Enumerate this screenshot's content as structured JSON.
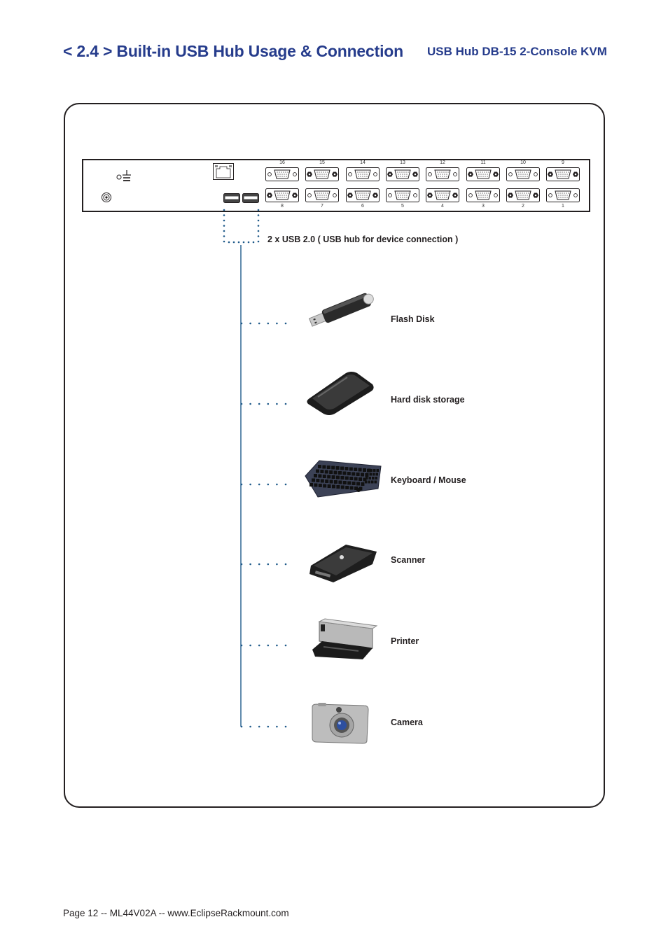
{
  "header": {
    "title": "< 2.4 > Built-in USB Hub Usage & Connection",
    "subtitle": "USB Hub  DB-15 2-Console KVM"
  },
  "rear_panel": {
    "top_row_ports": [
      {
        "number": "16",
        "screws": "plain"
      },
      {
        "number": "15",
        "screws": "hex"
      },
      {
        "number": "14",
        "screws": "plain"
      },
      {
        "number": "13",
        "screws": "hex"
      },
      {
        "number": "12",
        "screws": "plain"
      },
      {
        "number": "11",
        "screws": "hex"
      },
      {
        "number": "10",
        "screws": "plain"
      },
      {
        "number": "9",
        "screws": "hex"
      }
    ],
    "bottom_row_ports": [
      {
        "number": "8",
        "screws": "hex"
      },
      {
        "number": "7",
        "screws": "plain"
      },
      {
        "number": "6",
        "screws": "hex"
      },
      {
        "number": "5",
        "screws": "plain"
      },
      {
        "number": "4",
        "screws": "hex"
      },
      {
        "number": "3",
        "screws": "plain"
      },
      {
        "number": "2",
        "screws": "hex"
      },
      {
        "number": "1",
        "screws": "plain"
      }
    ],
    "icons": [
      "ground-icon",
      "bnc-connector-icon",
      "rj45-port-icon",
      "usb-port-icon",
      "usb-port-icon"
    ]
  },
  "usb_label": "2 x USB 2.0  ( USB hub for device connection )",
  "devices": [
    {
      "label": "Flash Disk",
      "icon": "flash-disk-icon"
    },
    {
      "label": "Hard disk storage",
      "icon": "hard-disk-icon"
    },
    {
      "label": "Keyboard  /  Mouse",
      "icon": "keyboard-icon"
    },
    {
      "label": "Scanner",
      "icon": "scanner-icon"
    },
    {
      "label": "Printer",
      "icon": "printer-icon"
    },
    {
      "label": "Camera",
      "icon": "camera-icon"
    }
  ],
  "colors": {
    "title": "#263c8c",
    "connector_line": "#1f5a8a",
    "text": "#231f20"
  },
  "footer": {
    "text": "Page 12 -- ML44V02A -- www.EclipseRackmount.com"
  }
}
